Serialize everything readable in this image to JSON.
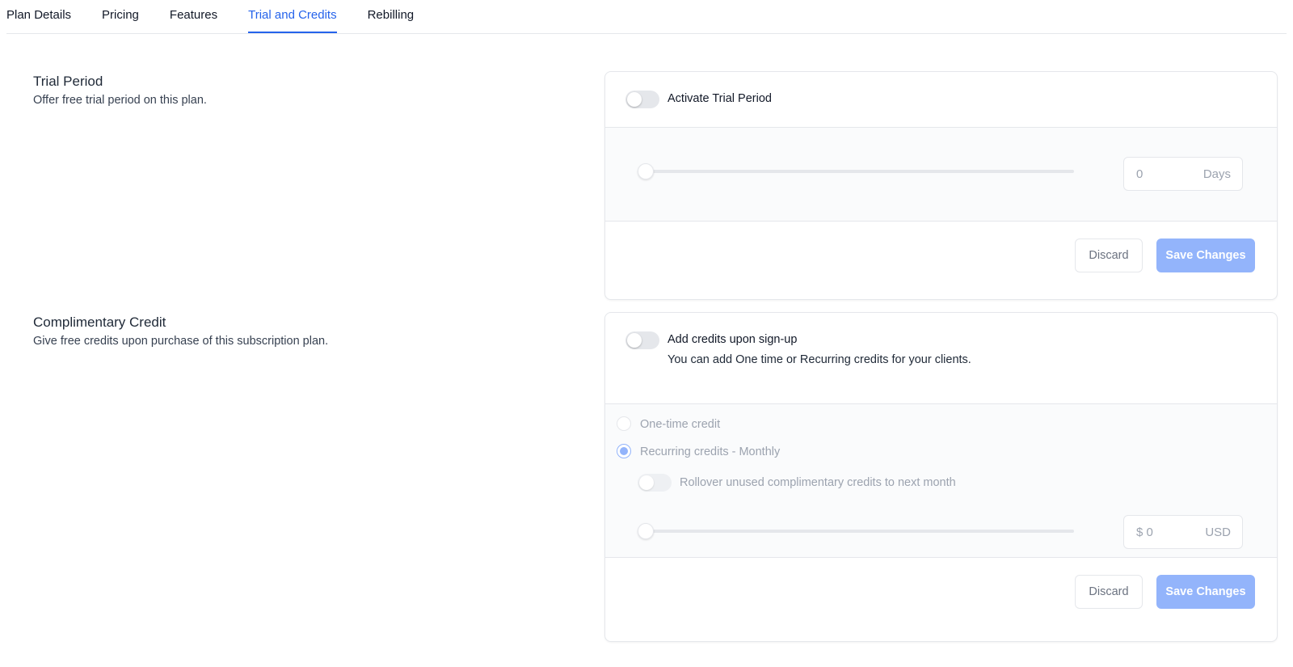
{
  "tabs": [
    {
      "label": "Plan Details",
      "active": false
    },
    {
      "label": "Pricing",
      "active": false
    },
    {
      "label": "Features",
      "active": false
    },
    {
      "label": "Trial and Credits",
      "active": true
    },
    {
      "label": "Rebilling",
      "active": false
    }
  ],
  "trial": {
    "title": "Trial Period",
    "description": "Offer free trial period on this plan.",
    "toggle_label": "Activate Trial Period",
    "toggle_on": false,
    "days_value": "0",
    "days_unit": "Days",
    "slider_fraction": 0,
    "discard_label": "Discard",
    "save_label": "Save Changes"
  },
  "credit": {
    "title": "Complimentary Credit",
    "description": "Give free credits upon purchase of this subscription plan.",
    "toggle_label": "Add credits upon sign-up",
    "toggle_on": false,
    "help": "You can add One time or Recurring credits for your clients.",
    "options": [
      {
        "label": "One-time credit",
        "checked": false
      },
      {
        "label": "Recurring credits - Monthly",
        "checked": true
      }
    ],
    "rollover_label": "Rollover unused complimentary credits to next month",
    "rollover_on": false,
    "amount_value": "$ 0",
    "amount_unit": "USD",
    "slider_fraction": 0,
    "discard_label": "Discard",
    "save_label": "Save Changes"
  },
  "colors": {
    "accent": "#2563eb",
    "save_disabled": "#93b4fb"
  }
}
